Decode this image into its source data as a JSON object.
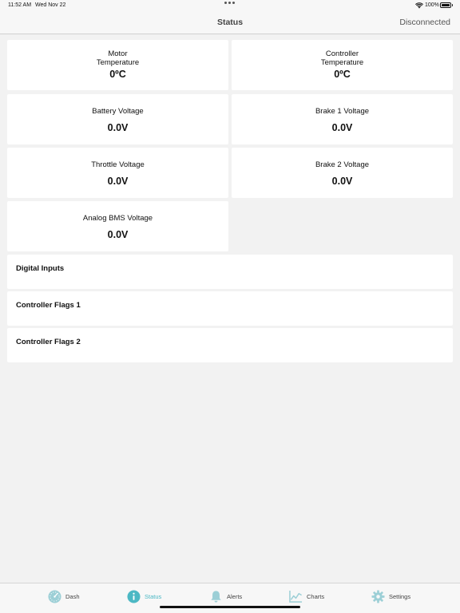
{
  "status_bar": {
    "time": "11:52 AM",
    "date": "Wed Nov 22",
    "battery": "100%"
  },
  "nav": {
    "title": "Status",
    "connection": "Disconnected"
  },
  "metrics": {
    "motor_temp": {
      "label_line1": "Motor",
      "label_line2": "Temperature",
      "value": "0ºC"
    },
    "controller_temp": {
      "label_line1": "Controller",
      "label_line2": "Temperature",
      "value": "0ºC"
    },
    "battery_voltage": {
      "label": "Battery Voltage",
      "value": "0.0V"
    },
    "brake1_voltage": {
      "label": "Brake 1 Voltage",
      "value": "0.0V"
    },
    "throttle_voltage": {
      "label": "Throttle Voltage",
      "value": "0.0V"
    },
    "brake2_voltage": {
      "label": "Brake 2 Voltage",
      "value": "0.0V"
    },
    "analog_bms_voltage": {
      "label": "Analog BMS Voltage",
      "value": "0.0V"
    }
  },
  "sections": {
    "digital_inputs": "Digital Inputs",
    "controller_flags_1": "Controller Flags 1",
    "controller_flags_2": "Controller Flags 2"
  },
  "tabs": {
    "dash": {
      "label": "Dash",
      "icon": "gauge-icon"
    },
    "status": {
      "label": "Status",
      "icon": "info-icon"
    },
    "alerts": {
      "label": "Alerts",
      "icon": "bell-icon"
    },
    "charts": {
      "label": "Charts",
      "icon": "chart-icon"
    },
    "settings": {
      "label": "Settings",
      "icon": "gear-icon"
    }
  },
  "colors": {
    "accent": "#4cb8c4",
    "background": "#f2f2f2",
    "card": "#ffffff"
  }
}
